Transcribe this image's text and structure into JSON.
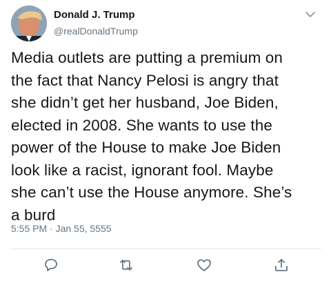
{
  "author": {
    "display_name": "Donald J. Trump",
    "handle": "@realDonaldTrump"
  },
  "tweet": {
    "text": "Media outlets are putting a premium on\nthe fact that Nancy Pelosi is angry that\nshe didn’t get her husband, Joe Biden,\nelected in 2008. She wants to use the\npower of the House to make Joe Biden\nlook like a racist, ignorant fool. Maybe\nshe can’t use the House anymore. She’s\na burd",
    "timestamp": "5:55 PM · Jan 55, 5555"
  },
  "actions": [
    "reply-icon",
    "retweet-icon",
    "like-icon",
    "share-icon"
  ],
  "colors": {
    "text": "#14171a",
    "secondary": "#657786",
    "divider": "#e1e8ed"
  }
}
